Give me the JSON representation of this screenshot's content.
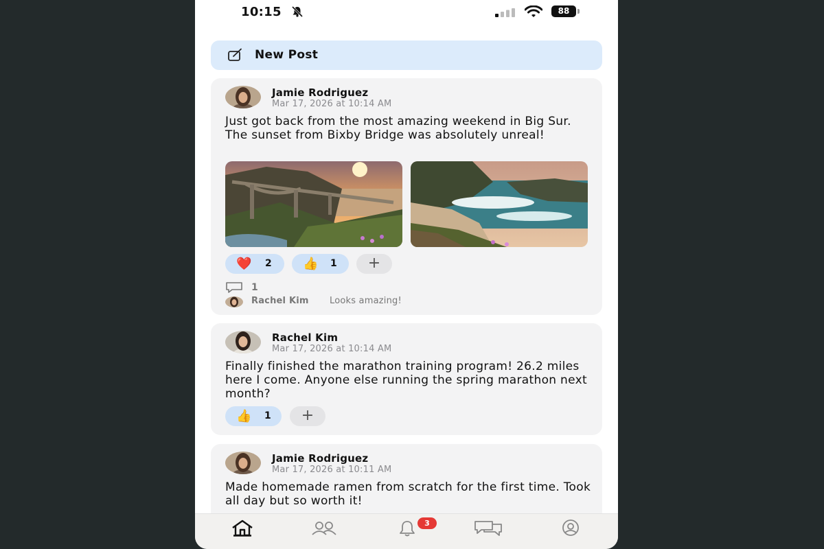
{
  "status": {
    "time": "10:15",
    "battery": "88"
  },
  "composer": {
    "label": "New Post"
  },
  "posts": [
    {
      "author": "Jamie Rodriguez",
      "timestamp": "Mar 17, 2026 at 10:14 AM",
      "text": "Just got back from the most amazing weekend in Big Sur. The sunset from Bixby Bridge was absolutely unreal!",
      "photos": [
        "bixby-bridge-sunset",
        "big-sur-cove"
      ],
      "reactions": [
        {
          "emoji": "❤️",
          "count": "2"
        },
        {
          "emoji": "👍",
          "count": "1"
        }
      ],
      "add_reaction": "+",
      "comment_count": "1",
      "comment": {
        "author": "Rachel Kim",
        "text": "Looks amazing!"
      }
    },
    {
      "author": "Rachel Kim",
      "timestamp": "Mar 17, 2026 at 10:14 AM",
      "text": "Finally finished the marathon training program! 26.2 miles here I come. Anyone else running the spring marathon next month?",
      "reactions": [
        {
          "emoji": "👍",
          "count": "1"
        }
      ],
      "add_reaction": "+"
    },
    {
      "author": "Jamie Rodriguez",
      "timestamp": "Mar 17, 2026 at 10:11 AM",
      "text": "Made homemade ramen from scratch for the first time. Took all day but so worth it!"
    }
  ],
  "tabbar": {
    "items": [
      "home-icon",
      "people-icon",
      "bell-icon",
      "chat-icon",
      "profile-icon"
    ],
    "active": "home-icon",
    "notification_badge": "3"
  },
  "colors": {
    "accent_light": "#dcebfb",
    "card": "#f3f3f4",
    "badge": "#e53935",
    "reaction_chip": "#cfe2f8"
  }
}
